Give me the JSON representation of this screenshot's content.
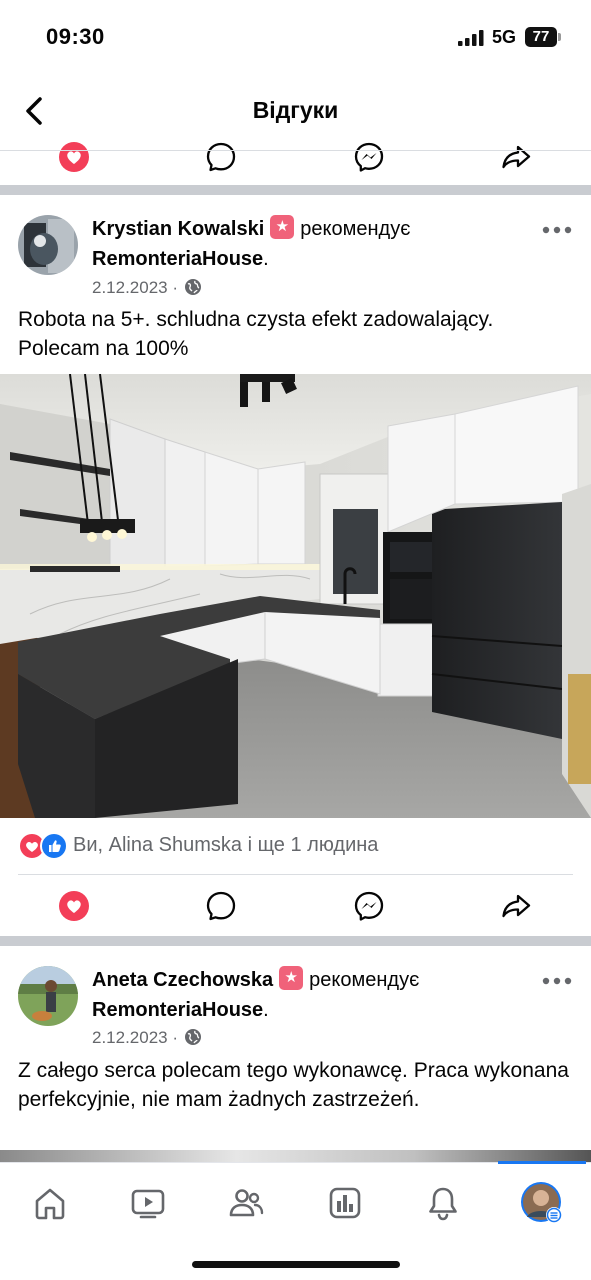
{
  "status": {
    "time": "09:30",
    "network": "5G",
    "battery": "77"
  },
  "header": {
    "title": "Відгуки",
    "back_icon": "chevron-left-icon"
  },
  "actions": {
    "love": "heart-icon",
    "comment": "comment-icon",
    "messenger": "messenger-icon",
    "share": "share-icon"
  },
  "posts": [
    {
      "author": "Krystian Kowalski",
      "recommends": "рекомендує",
      "page": "RemonteriaHouse",
      "date": "2.12.2023",
      "dot": "·",
      "text": "Robota na 5+. schludna czysta efekt zadowalający. Polecam na 100%",
      "reactions": "Ви, Alina Shumska і ще 1 людина"
    },
    {
      "author": "Aneta Czechowska",
      "recommends": "рекомендує",
      "page": "RemonteriaHouse",
      "date": "2.12.2023",
      "dot": "·",
      "text": "Z całego serca polecam tego wykonawcę. Praca wykonana perfekcyjnie, nie mam żadnych zastrzeżeń."
    }
  ],
  "tabs": [
    "home-icon",
    "video-icon",
    "friends-icon",
    "dashboard-icon",
    "bell-icon",
    "profile-icon"
  ],
  "colors": {
    "brand": "#1877f2",
    "love": "#f33e58",
    "recommend_badge": "#f0627a",
    "meta": "#65676b"
  }
}
